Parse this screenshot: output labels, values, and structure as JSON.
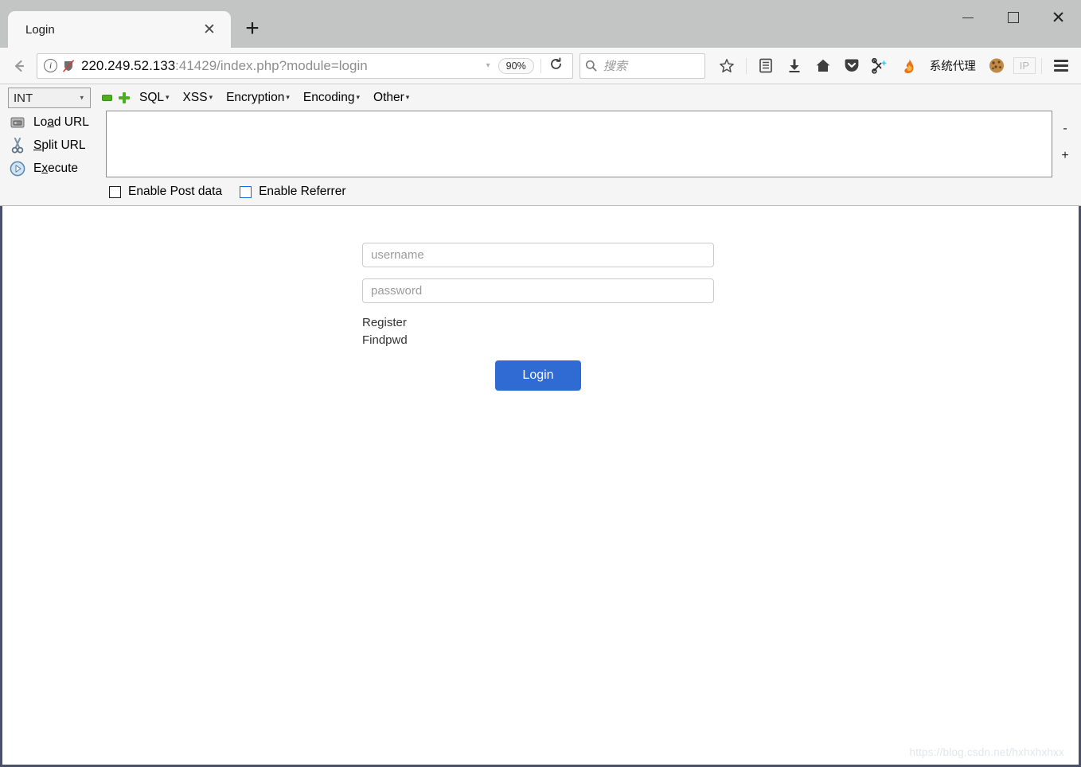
{
  "window": {
    "controls": {
      "minimize": "—",
      "maximize": "□",
      "close": "✕"
    }
  },
  "tabs": [
    {
      "title": "Login",
      "close_label": "✕"
    }
  ],
  "newtab_label": "+",
  "nav": {
    "back_label": "←",
    "identity_icons": [
      "info-icon",
      "shield-crossed-icon"
    ],
    "url_host": "220.249.52.133",
    "url_rest": ":41429/index.php?module=login",
    "url_full": "220.249.52.133:41429/index.php?module=login",
    "dropdown_caret": "▾",
    "zoom_level": "90%",
    "reload_label": "⟳"
  },
  "search": {
    "placeholder": "搜索",
    "icon": "search-icon"
  },
  "toolbar": {
    "icons": [
      {
        "name": "bookmark-star-icon",
        "glyph": "☆"
      },
      {
        "name": "library-icon",
        "glyph": "▤"
      },
      {
        "name": "downloads-icon",
        "glyph": "⬇"
      },
      {
        "name": "home-icon",
        "glyph": "⌂"
      },
      {
        "name": "pocket-icon",
        "glyph": "▼"
      },
      {
        "name": "fireshot-icon",
        "glyph": "✂"
      },
      {
        "name": "hackbar-flame-icon",
        "glyph": "🔥"
      }
    ],
    "proxy_label": "系统代理",
    "cookie_icon": "cookie-icon",
    "ip_badge": "IP",
    "menu_icon": "hamburger-menu-icon"
  },
  "hackbar": {
    "type_select": {
      "value": "INT",
      "caret": "▾"
    },
    "minus_icon": "minus-green-icon",
    "plus_icon": "plus-green-icon",
    "menus": [
      {
        "label": "SQL",
        "caret": "▾"
      },
      {
        "label": "XSS",
        "caret": "▾"
      },
      {
        "label": "Encryption",
        "caret": "▾"
      },
      {
        "label": "Encoding",
        "caret": "▾"
      },
      {
        "label": "Other",
        "caret": "▾"
      }
    ],
    "actions": [
      {
        "name": "load-url",
        "pre": "Lo",
        "accel": "a",
        "post": "d URL",
        "icon": "disk-icon"
      },
      {
        "name": "split-url",
        "pre": "",
        "accel": "S",
        "post": "plit URL",
        "icon": "scissors-icon"
      },
      {
        "name": "execute",
        "pre": "E",
        "accel": "x",
        "post": "ecute",
        "icon": "play-icon"
      }
    ],
    "textarea_value": "",
    "textarea_placeholder": "",
    "resize_minus": "-",
    "resize_plus": "+",
    "checkboxes": [
      {
        "label": "Enable Post data",
        "checked": false,
        "focused": false
      },
      {
        "label": "Enable Referrer",
        "checked": false,
        "focused": true
      }
    ]
  },
  "page": {
    "username_placeholder": "username",
    "username_value": "",
    "password_placeholder": "password",
    "password_value": "",
    "register_link": "Register",
    "findpwd_link": "Findpwd",
    "login_button": "Login",
    "watermark": "https://blog.csdn.net/hxhxhxhxx",
    "accent_color": "#2f6bd3"
  }
}
